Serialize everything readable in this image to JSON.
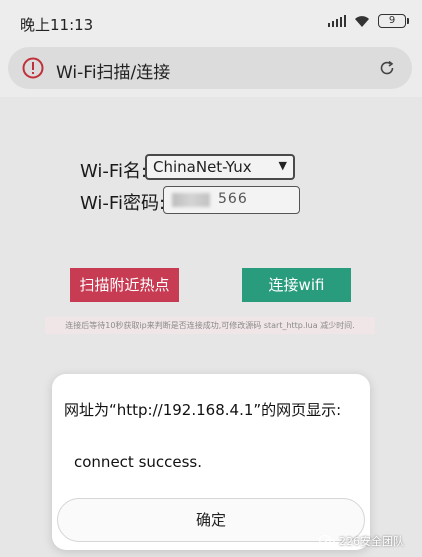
{
  "status_bar": {
    "time": "晚上11:13",
    "battery": "9",
    "icons": [
      "signal-icon",
      "wifi-icon",
      "battery-icon"
    ]
  },
  "address_bar": {
    "title": "Wi-Fi扫描/连接",
    "icons": [
      "alert-icon",
      "reload-icon"
    ],
    "alert_color": "#c0303b"
  },
  "form": {
    "ssid_label": "Wi-Fi名:",
    "ssid_value": "ChinaNet-Yux",
    "password_label": "Wi-Fi密码:",
    "password_value": "566"
  },
  "buttons": {
    "scan_label": "扫描附近热点",
    "connect_label": "连接wifi",
    "scan_color": "#c73b53",
    "connect_color": "#2a9c7e"
  },
  "hint": "连接后等待10秒获取ip来判断是否连接成功,可修改源码 start_http.lua 减少时间.",
  "dialog": {
    "title": "网址为“http://192.168.4.1”的网页显示:",
    "message": "connect success.",
    "confirm_label": "确定"
  },
  "watermark": {
    "text": "226安全团队",
    "icon": "wechat-icon"
  }
}
